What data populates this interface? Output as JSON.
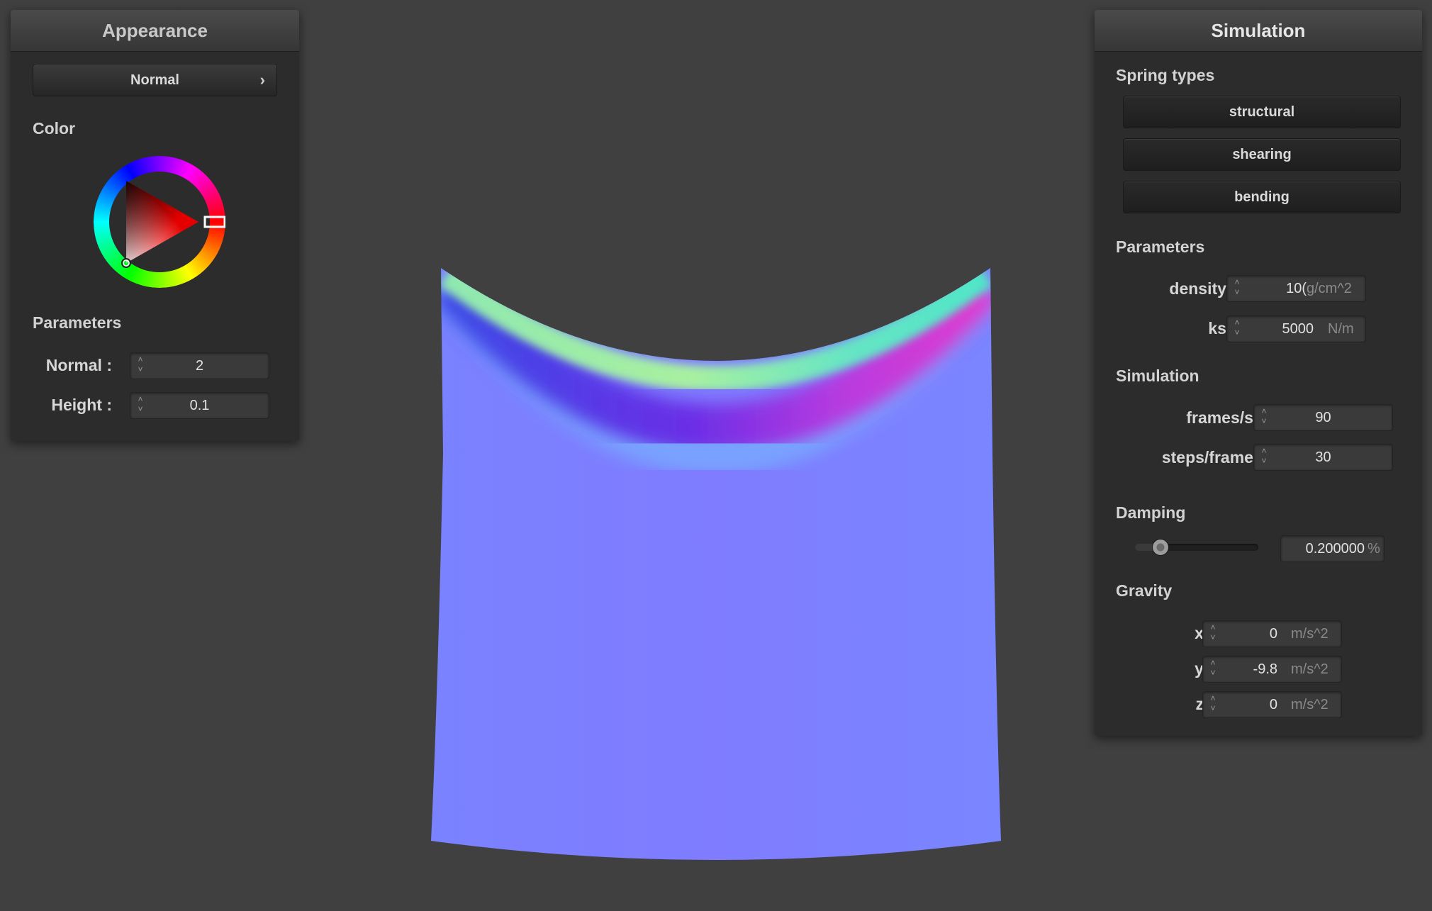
{
  "appearance_panel": {
    "title": "Appearance",
    "shader_dropdown": {
      "value": "Normal"
    },
    "color_label": "Color",
    "color_picker": {
      "selected_hue": "#ff0000"
    },
    "parameters_label": "Parameters",
    "normal": {
      "label": "Normal :",
      "value": "2"
    },
    "height": {
      "label": "Height :",
      "value": "0.1"
    }
  },
  "simulation_panel": {
    "title": "Simulation",
    "spring_types_label": "Spring types",
    "spring_buttons": [
      "structural",
      "shearing",
      "bending"
    ],
    "parameters_label": "Parameters",
    "density": {
      "label": "density :",
      "value": "10(",
      "unit": "g/cm^2"
    },
    "ks": {
      "label": "ks :",
      "value": "5000",
      "unit": "N/m"
    },
    "simulation_label": "Simulation",
    "frames_per_sec": {
      "label": "frames/s :",
      "value": "90"
    },
    "steps_per_frame": {
      "label": "steps/frame :",
      "value": "30"
    },
    "damping_label": "Damping",
    "damping": {
      "value": "0.200000",
      "unit": "%",
      "slider_fraction": 0.2
    },
    "gravity_label": "Gravity",
    "gravity_x": {
      "label": "x :",
      "value": "0",
      "unit": "m/s^2"
    },
    "gravity_y": {
      "label": "y :",
      "value": "-9.8",
      "unit": "m/s^2"
    },
    "gravity_z": {
      "label": "z :",
      "value": "0",
      "unit": "m/s^2"
    }
  },
  "colors": {
    "background": "#404040",
    "panel": "#2c2c2c",
    "cloth_base": "#7f7fff"
  },
  "icons": {
    "dropdown": "chevron-right-icon",
    "spinner": "up-down-spinner-icon",
    "color_wheel": "hue-ring-with-triangle"
  }
}
